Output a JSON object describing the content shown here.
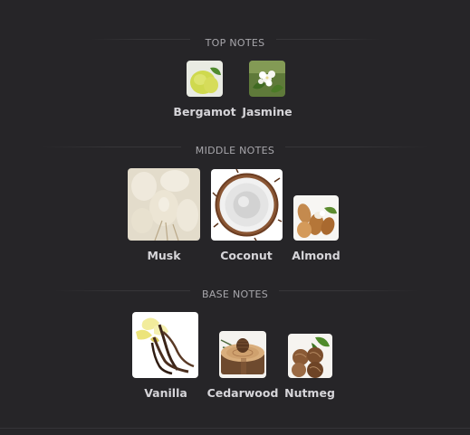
{
  "sections": {
    "top": {
      "title": "TOP NOTES",
      "notes": [
        {
          "label": "Bergamot",
          "icon": "bergamot-image"
        },
        {
          "label": "Jasmine",
          "icon": "jasmine-image"
        }
      ]
    },
    "middle": {
      "title": "MIDDLE NOTES",
      "notes": [
        {
          "label": "Musk",
          "icon": "musk-image"
        },
        {
          "label": "Coconut",
          "icon": "coconut-image"
        },
        {
          "label": "Almond",
          "icon": "almond-image"
        }
      ]
    },
    "base": {
      "title": "BASE NOTES",
      "notes": [
        {
          "label": "Vanilla",
          "icon": "vanilla-image"
        },
        {
          "label": "Cedarwood",
          "icon": "cedarwood-image"
        },
        {
          "label": "Nutmeg",
          "icon": "nutmeg-image"
        }
      ]
    }
  },
  "colors": {
    "background": "#262528",
    "section_title": "#a7a6ab",
    "note_label": "#d6d5d9"
  }
}
